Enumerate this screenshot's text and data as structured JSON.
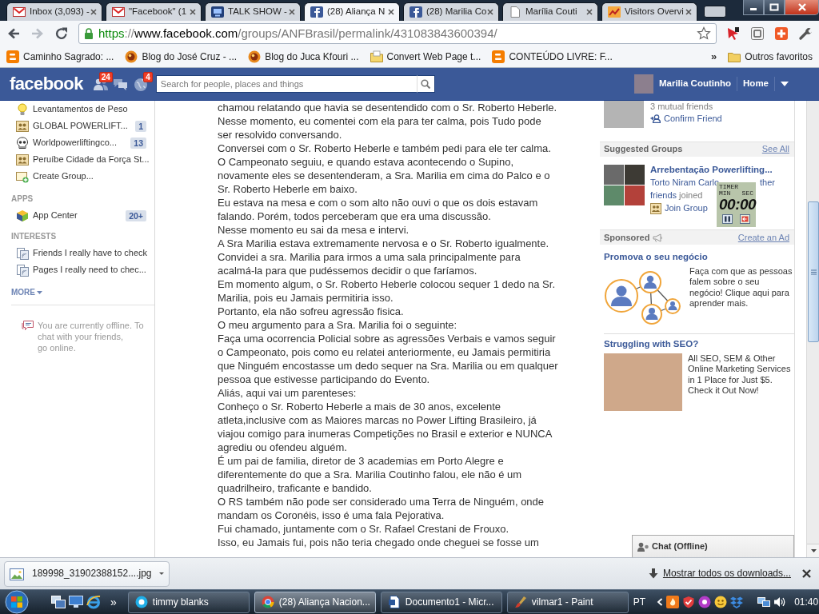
{
  "browser": {
    "tabs": [
      {
        "title": "Inbox (3,093) -",
        "kind": "mail",
        "selected": false
      },
      {
        "title": "\"Facebook\" (1",
        "kind": "mail",
        "selected": false
      },
      {
        "title": "TALK SHOW -",
        "kind": "tv",
        "selected": false
      },
      {
        "title": "(28) Aliança N",
        "kind": "social",
        "selected": true
      },
      {
        "title": "(28) Marilia Co",
        "kind": "social",
        "selected": false
      },
      {
        "title": "Marília Couti",
        "kind": "page",
        "selected": false
      },
      {
        "title": "Visitors Overvi",
        "kind": "chart",
        "selected": false
      }
    ],
    "forward_disabled": true,
    "address": [
      {
        "text": "https",
        "kind": "scheme"
      },
      {
        "text": "://",
        "kind": "punct"
      },
      {
        "text": "www.facebook.com",
        "kind": "host"
      },
      {
        "text": "/groups/ANFBrasil/permalink/431083843600394/",
        "kind": "path"
      }
    ],
    "bookmarks": [
      {
        "label": "Caminho Sagrado: ...",
        "kind": "blog"
      },
      {
        "label": "Blog do José Cruz - ...",
        "kind": "globe"
      },
      {
        "label": "Blog do Juca Kfouri ...",
        "kind": "globe"
      },
      {
        "label": "Convert Web Page t...",
        "kind": "folder"
      },
      {
        "label": "CONTEÚDO LIVRE: F...",
        "kind": "blog"
      }
    ],
    "bookmarks_more": "»",
    "other_bookmarks": "Outros favoritos"
  },
  "facebook_bar": {
    "logo": "facebook",
    "jewels": [
      {
        "kind": "friends",
        "badge": "24"
      },
      {
        "kind": "messages"
      },
      {
        "kind": "notifications",
        "badge": "4"
      }
    ],
    "search_placeholder": "Search for people, places and things",
    "user": "Marilia Coutinho",
    "home": "Home"
  },
  "sidebar": {
    "groups": [
      {
        "label": "Levantamentos de Peso",
        "kind": "bulb"
      },
      {
        "label": "GLOBAL POWERLIFT...",
        "kind": "group",
        "count": "1"
      },
      {
        "label": "Worldpowerliftingco...",
        "kind": "skull",
        "count": "13"
      },
      {
        "label": "Peruíbe Cidade da Força St...",
        "kind": "group"
      },
      {
        "label": "Create Group...",
        "kind": "create"
      }
    ],
    "apps": {
      "heading": "APPS",
      "items": [
        {
          "label": "App Center",
          "kind": "cube",
          "count": "20+"
        }
      ]
    },
    "interests": {
      "heading": "INTERESTS",
      "items": [
        {
          "label": "Friends I really have to check",
          "kind": "list"
        },
        {
          "label": "Pages I really need to chec...",
          "kind": "list"
        }
      ]
    },
    "more": "MORE",
    "chat_notice": {
      "text": "You are currently offline. To chat with your friends,",
      "link": "go online."
    }
  },
  "post": {
    "paragraphs": [
      [
        "chamou relatando que havia se desentendido com o Sr. Roberto Heberle."
      ],
      [
        "Nesse momento, eu comentei com ela para ter calma, pois Tudo pode",
        "ser resolvido conversando."
      ],
      [
        "Conversei com o Sr. Roberto Heberle e também pedi para ele ter calma."
      ],
      [
        "O Campeonato seguiu, e quando estava acontecendo o Supino,",
        "novamente eles se desentenderam, a Sra. Marilia em cima do Palco e o",
        "Sr. Roberto Heberle em baixo."
      ],
      [
        "Eu estava na mesa e com o som alto não ouvi o que os dois estavam",
        "falando. Porém, todos perceberam que era uma discussão."
      ],
      [
        "Nesse momento eu sai da mesa e intervi."
      ],
      [
        "A Sra Marilia estava extremamente nervosa e o Sr. Roberto igualmente."
      ],
      [
        "Convidei a sra. Marilia para irmos a uma sala principalmente para",
        "acalmá-la para que pudéssemos decidir o que faríamos."
      ],
      [
        "Em momento algum, o Sr. Roberto Heberle colocou sequer 1 dedo na Sr.",
        "Marilia, pois eu Jamais permitiria isso."
      ],
      [
        "Portanto, ela não sofreu agressão fisica."
      ],
      [
        "O meu argumento para a Sra. Marilia foi o seguinte:"
      ],
      [
        "Faça uma ocorrencia Policial sobre as agressões Verbais e vamos seguir",
        "o Campeonato, pois como eu relatei anteriormente, eu Jamais permitiria",
        "que Ninguém encostasse um dedo sequer na Sra. Marilia ou em qualquer",
        "pessoa que estivesse participando do Evento."
      ],
      [
        "Aliás, aqui vai um parenteses:"
      ],
      [
        "Conheço o Sr. Roberto Heberle a mais de 30 anos, excelente",
        "atleta,inclusive com as Maiores marcas no Power Lifting Brasileiro, já",
        "viajou comigo para inumeras Competições no Brasil e exterior e NUNCA",
        "agrediu ou ofendeu alguém."
      ],
      [
        "É um pai de familia, diretor de 3 academias em Porto Alegre e",
        "diferentemente do que a Sra. Marilia Coutinho falou, ele não é um",
        "quadrilheiro, traficante e bandido."
      ],
      [
        "O RS também não pode ser considerado uma Terra de Ninguém, onde",
        "mandam os Coronéis, isso é uma fala Pejorativa."
      ],
      [
        "Fui chamado, juntamente com o Sr. Rafael Crestani de Frouxo."
      ],
      [
        "Isso, eu Jamais fui, pois não teria chegado onde cheguei se fosse um"
      ]
    ]
  },
  "right_column": {
    "friend_request": {
      "mutual": "3 mutual friends",
      "action": "Confirm Friend"
    },
    "suggested_groups": {
      "title": "Suggested Groups",
      "see_all": "See All",
      "name": "Arrebentação Powerlifting...",
      "members": [
        "Torto Niram Carlo",
        "ther"
      ],
      "friends": "friends",
      "joined": "joined",
      "join": "Join Group"
    },
    "timer": {
      "title": "TIMER",
      "min": "MIN",
      "sec": "SEC",
      "time": "00:00"
    },
    "sponsored": {
      "title": "Sponsored",
      "create_ad": "Create an Ad",
      "ads": [
        {
          "title": "Promova o seu negócio",
          "kind": "illustration",
          "body": "Faça com que as pessoas falem sobre o seu negócio! Clique aqui para aprender mais."
        },
        {
          "title": "Struggling with SEO?",
          "kind": "photo",
          "body": "All SEO, SEM & Other Online Marketing Services in 1 Place for Just $5. Check it Out Now!"
        }
      ]
    },
    "chat_bar": "Chat (Offline)"
  },
  "downloads": {
    "file": "189998_31902388152....jpg",
    "show_all": "Mostrar todos os downloads..."
  },
  "taskbar": {
    "quick_launch_more": "»",
    "tasks": [
      {
        "label": "timmy blanks",
        "kind": "chat",
        "selected": false
      },
      {
        "label": "(28) Aliança Nacion...",
        "kind": "browser",
        "selected": true
      },
      {
        "label": "Documento1 - Micr...",
        "kind": "document",
        "selected": false
      },
      {
        "label": "vilmar1 - Paint",
        "kind": "paint",
        "selected": false
      }
    ],
    "language": "PT",
    "clock": "01:40"
  }
}
